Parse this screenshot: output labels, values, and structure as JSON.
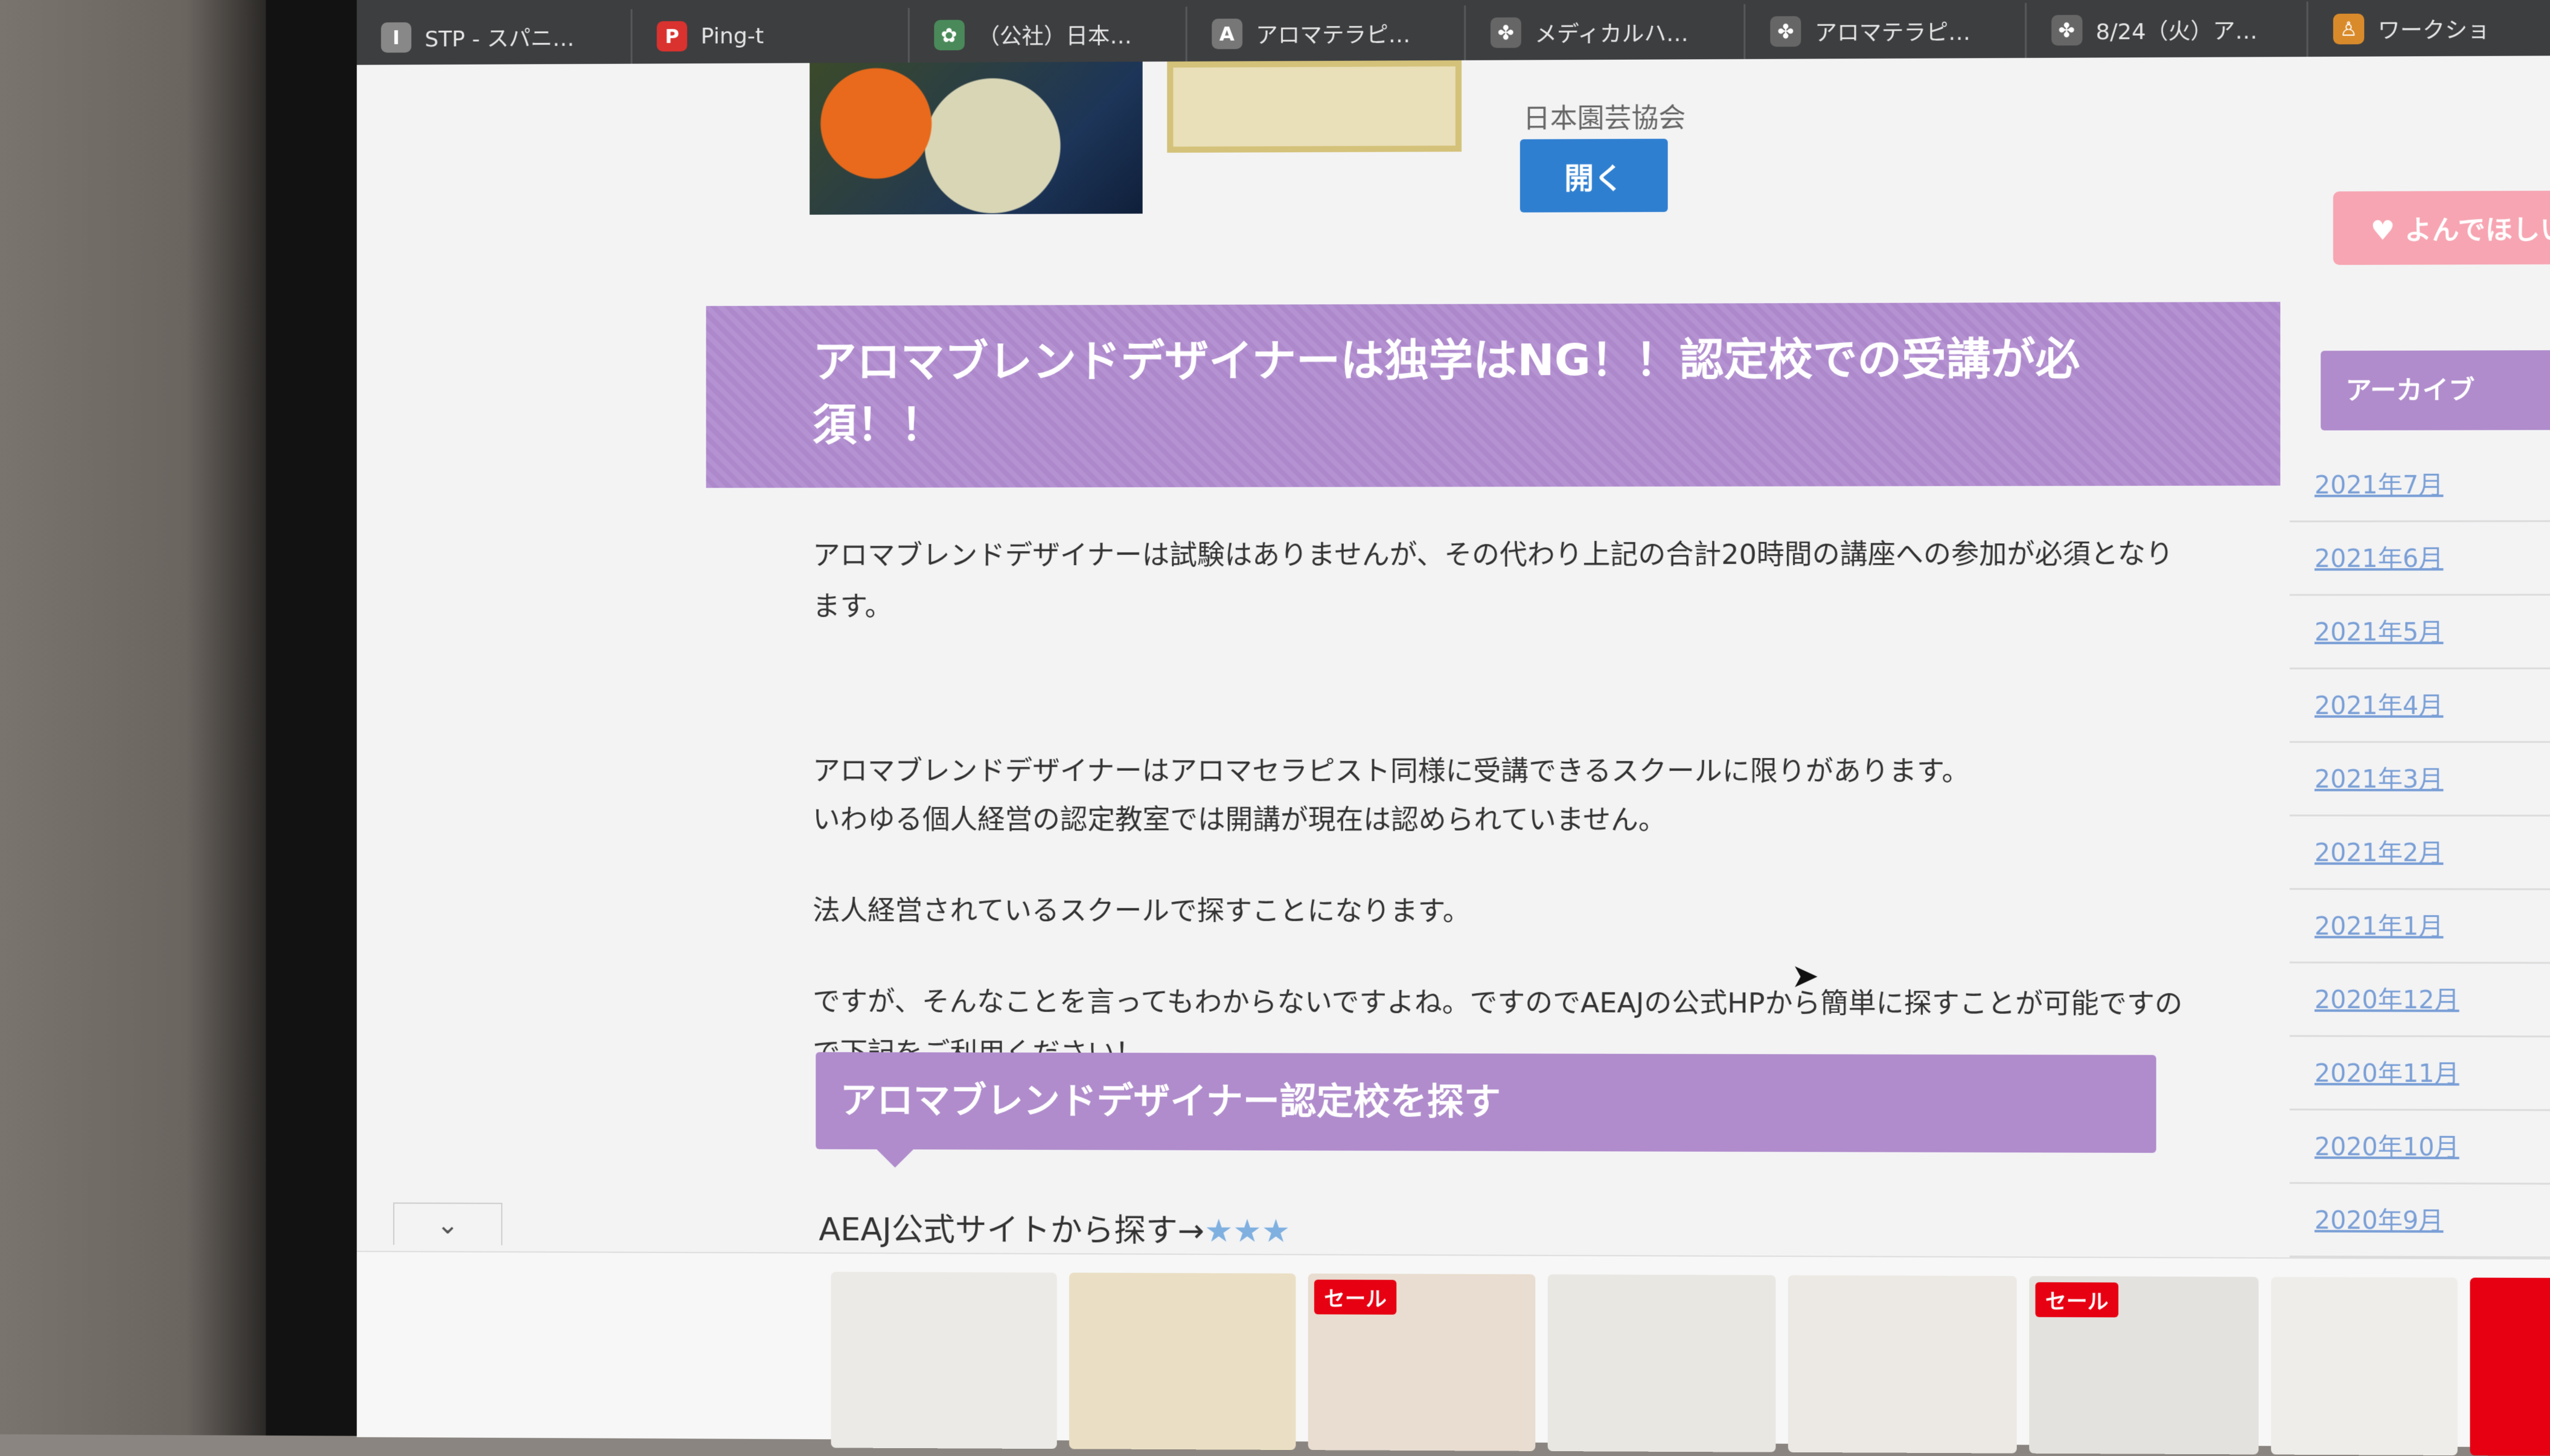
{
  "tabs": [
    {
      "label": "STP - スパニ…",
      "icon": "I",
      "color": "#888888"
    },
    {
      "label": "Ping-t",
      "icon": "P",
      "color": "#d9322f"
    },
    {
      "label": "（公社）日本…",
      "icon": "✿",
      "color": "#4a8a5a"
    },
    {
      "label": "アロマテラピ…",
      "icon": "A",
      "color": "#777777"
    },
    {
      "label": "メディカルハ…",
      "icon": "✤",
      "color": "#666666"
    },
    {
      "label": "アロマテラピ…",
      "icon": "✤",
      "color": "#666666"
    },
    {
      "label": "8/24（火）ア…",
      "icon": "✤",
      "color": "#666666"
    },
    {
      "label": "ワークショ",
      "icon": "♙",
      "color": "#d98b2b"
    }
  ],
  "top": {
    "org_name": "日本園芸協会",
    "open_button": "開く"
  },
  "article": {
    "heading": "アロマブレンドデザイナーは独学はNG！！認定校での受講が必須！！",
    "highlight": "アロマブレンドデザイナーは試験はありませんが、その代わり上記の合計20時間の講座への参加が必須となります。",
    "p1": "アロマブレンドデザイナーはアロマセラピスト同様に受講できるスクールに限りがあります。",
    "p2": "いわゆる個人経営の認定教室では開講が現在は認められていません。",
    "p3": "法人経営されているスクールで探すことになります。",
    "p4": "ですが、そんなことを言ってもわからないですよね。ですのでAEAJの公式HPから簡単に探すことが可能ですので下記をご利用ください！",
    "subheading": "アロマブレンドデザイナー認定校を探す",
    "aeaj_text": "AEAJ公式サイトから探す→",
    "aeaj_stars": "★★★"
  },
  "sidebar": {
    "like_button": "♥ よんでほしい",
    "archive_title": "アーカイブ",
    "archive_items": [
      "2021年7月",
      "2021年6月",
      "2021年5月",
      "2021年4月",
      "2021年3月",
      "2021年2月",
      "2021年1月",
      "2020年12月",
      "2020年11月",
      "2020年10月",
      "2020年9月"
    ]
  },
  "adbar": {
    "collapse_icon": "chevron-down-icon",
    "sale_label": "セール"
  },
  "colors": {
    "heading_purple": "#b592d2",
    "button_blue": "#2f7fd1",
    "link_blue": "#7a9fd6",
    "sale_red": "#e60012"
  }
}
